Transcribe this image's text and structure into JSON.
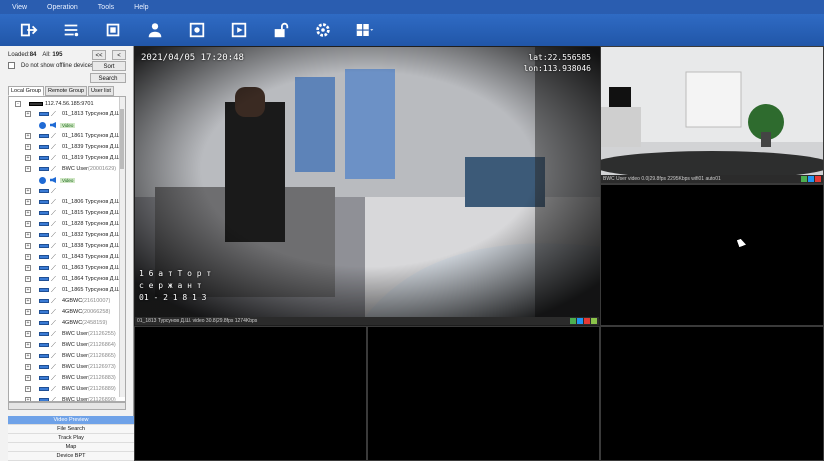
{
  "menubar": {
    "items": [
      "View",
      "Operation",
      "Tools",
      "Help"
    ]
  },
  "toolbar": {
    "buttons": [
      "logout-icon",
      "device-list-icon",
      "fullscreen-icon",
      "user-icon",
      "snapshot-icon",
      "record-play-icon",
      "unlock-icon",
      "settings-icon",
      "layout-icon"
    ]
  },
  "sidebar": {
    "loaded_label": "Loaded:",
    "loaded_value": "84",
    "all_label": "All:",
    "all_value": "195",
    "prev_label": "<<",
    "next_label": "<",
    "offline_label": "Do not show offline devices",
    "sort_label": "Sort",
    "search_label": "Search",
    "tabs": [
      "Local Group",
      "Remote Group",
      "User list"
    ],
    "root_label": "112.74.56.185:9701",
    "video_label": "Video",
    "devices": [
      {
        "label": "01_1813 Турсунов Д.Ш.",
        "gray": ""
      },
      {
        "label": "01_1861 Турсунов Д.Ш.",
        "gray": ""
      },
      {
        "label": "01_1839 Турсунов Д.Ш.",
        "gray": ""
      },
      {
        "label": "01_1819 Турсунов Д.Ш.",
        "gray": ""
      },
      {
        "label": "BWC User",
        "gray": "(20001629)"
      },
      {
        "label": "",
        "gray": ""
      },
      {
        "label": "01_1806 Турсунов Д.Ш.",
        "gray": ""
      },
      {
        "label": "01_1815 Турсунов Д.Ш.",
        "gray": ""
      },
      {
        "label": "01_1828 Турсунов Д.Ш.",
        "gray": ""
      },
      {
        "label": "01_1832 Турсунов Д.Ш.",
        "gray": ""
      },
      {
        "label": "01_1838 Турсунов Д.Ш.",
        "gray": ""
      },
      {
        "label": "01_1843 Турсунов Д.Ш.",
        "gray": ""
      },
      {
        "label": "01_1863 Турсунов Д.Ш.",
        "gray": ""
      },
      {
        "label": "01_1864 Турсунов Д.Ш.",
        "gray": ""
      },
      {
        "label": "01_1865 Турсунов Д.Ш.",
        "gray": ""
      },
      {
        "label": "4GBWC",
        "gray": "(21610007)"
      },
      {
        "label": "4GBWC",
        "gray": "(20066258)"
      },
      {
        "label": "4GBWC",
        "gray": "(2458159)"
      },
      {
        "label": "BWC User",
        "gray": "(21126255)"
      },
      {
        "label": "BWC User",
        "gray": "(21126864)"
      },
      {
        "label": "BWC User",
        "gray": "(21126865)"
      },
      {
        "label": "BWC User",
        "gray": "(21126973)"
      },
      {
        "label": "BWC User",
        "gray": "(21126883)"
      },
      {
        "label": "BWC User",
        "gray": "(21126889)"
      },
      {
        "label": "BWC User",
        "gray": "(21126890)"
      }
    ]
  },
  "nav": {
    "items": [
      "Video Preview",
      "File Search",
      "Track Play",
      "Map",
      "Device BPT"
    ]
  },
  "video": {
    "main_timestamp": "2021/04/05 17:20:48",
    "main_lat": "lat:22.556585",
    "main_lon": "lon:113.938046",
    "main_name_line1": "1 6 a т  Т o р т",
    "main_name_line2": "c e p ж a н т",
    "main_name_line3": "01 - 2 1 8 1 3",
    "main_status": "01_1813 Турсунов Д.Ш. video  30.8|29.8fps 1274Kbps",
    "side_status": "BWC User video   0.0|29.8fps 2295Kbps  wifi01 auto01"
  },
  "colors": {
    "menubar": "#2a5db0",
    "toolbar": "#2156a8",
    "nav_active": "#6fa2e8"
  }
}
